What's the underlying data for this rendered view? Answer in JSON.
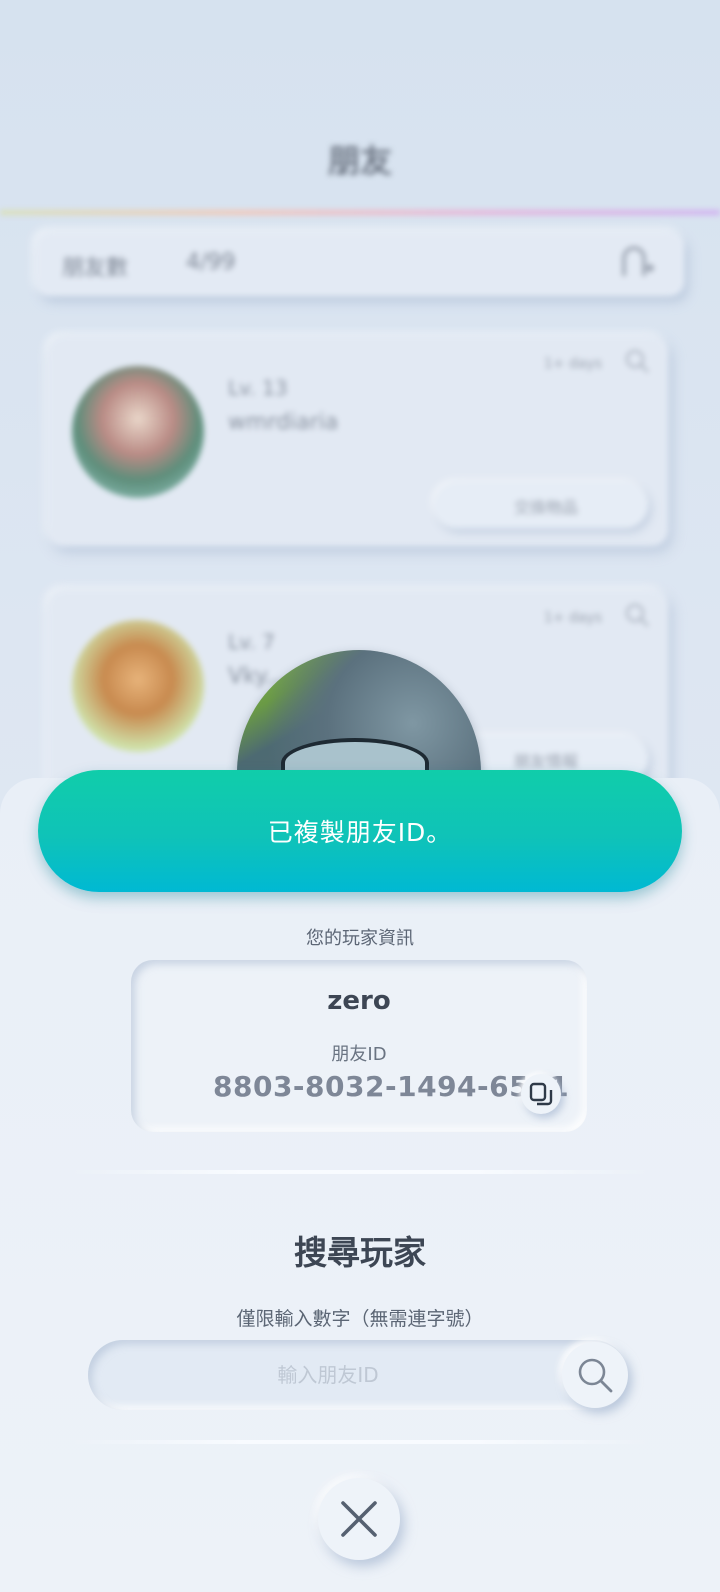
{
  "background": {
    "title": "朋友",
    "friend_count_label": "朋友數",
    "friend_count_value": "4/99",
    "friends": [
      {
        "level": "Lv. 13",
        "name": "wmrdiaria",
        "last_seen": "1+ days",
        "action": "交換物品"
      },
      {
        "level": "Lv. 7",
        "name": "Vky...",
        "last_seen": "1+ days",
        "action": "朋友情報"
      }
    ]
  },
  "toast": {
    "message": "已複製朋友ID。"
  },
  "player_info": {
    "section_label": "您的玩家資訊",
    "name": "zero",
    "friend_id_label": "朋友ID",
    "friend_id": "8803-8032-1494-6501"
  },
  "search": {
    "title": "搜尋玩家",
    "hint": "僅限輸入數字（無需連字號）",
    "placeholder": "輸入朋友ID"
  },
  "icons": {
    "copy": "copy-icon",
    "search": "search-icon",
    "close": "close-icon",
    "add_friend": "add-friend-icon"
  },
  "colors": {
    "toast_start": "#10cdaa",
    "toast_end": "#00b9d3",
    "background": "#dbe6f3",
    "sheet": "#edf2f8"
  }
}
